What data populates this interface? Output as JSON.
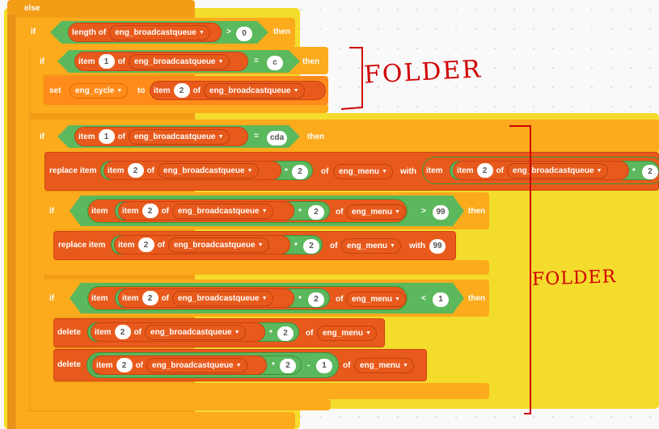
{
  "kw": {
    "else": "else",
    "if": "if",
    "then": "then",
    "set": "set",
    "to": "to",
    "replace_item": "replace item",
    "with": "with",
    "delete": "delete",
    "length_of": "length of",
    "item": "item",
    "of": "of"
  },
  "vars": {
    "queue": "eng_broadcastqueue",
    "menu": "eng_menu",
    "cycle": "eng_cycle"
  },
  "ops": {
    "gt": ">",
    "lt": "<",
    "eq": "=",
    "mul": "*",
    "minus": "-"
  },
  "values": {
    "zero": "0",
    "one": "1",
    "two": "2",
    "c": "c",
    "cda": "cda",
    "ninetynine": "99"
  },
  "annotations": {
    "label": "FOLDER",
    "label2": "FOLDER"
  },
  "colors": {
    "control": "#fbab1c",
    "data": "#e85a1c",
    "operator": "#5cb85c",
    "highlight": "#f4dc2c",
    "ink": "#d00000"
  }
}
